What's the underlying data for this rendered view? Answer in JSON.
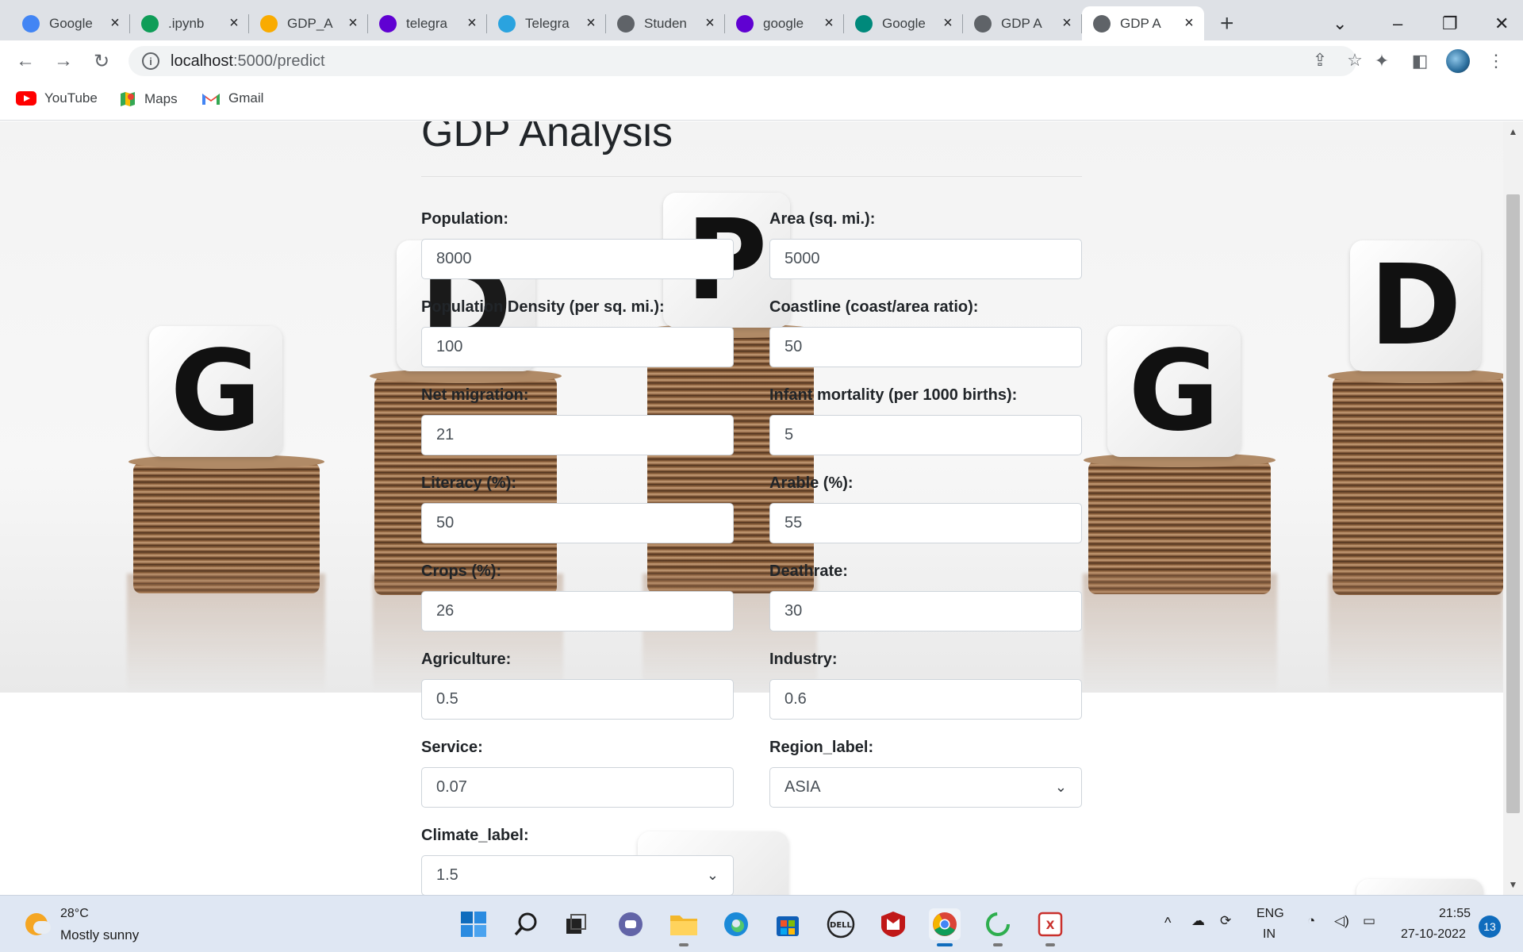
{
  "browser": {
    "tabs": [
      {
        "title": "Google",
        "favicon": "google-icon",
        "color": "#4285f4",
        "active": false
      },
      {
        "title": ".ipynb",
        "favicon": "drive-icon",
        "color": "#0f9d58",
        "active": false
      },
      {
        "title": "GDP_A",
        "favicon": "colab-icon",
        "color": "#f9ab00",
        "active": false
      },
      {
        "title": "telegra",
        "favicon": "yahoo-icon",
        "color": "#6001d2",
        "active": false
      },
      {
        "title": "Telegra",
        "favicon": "telegram-icon",
        "color": "#2aa3df",
        "active": false
      },
      {
        "title": "Studen",
        "favicon": "globe-icon",
        "color": "#5f6368",
        "active": false
      },
      {
        "title": "google",
        "favicon": "yahoo-icon",
        "color": "#6001d2",
        "active": false
      },
      {
        "title": "Google",
        "favicon": "meet-icon",
        "color": "#00897b",
        "active": false
      },
      {
        "title": "GDP A",
        "favicon": "globe-icon",
        "color": "#5f6368",
        "active": false
      },
      {
        "title": "GDP A",
        "favicon": "globe-icon",
        "color": "#5f6368",
        "active": true
      }
    ],
    "url_host": "localhost",
    "url_rest": ":5000/predict",
    "bookmarks": [
      {
        "label": "YouTube",
        "icon": "youtube-icon"
      },
      {
        "label": "Maps",
        "icon": "maps-icon"
      },
      {
        "label": "Gmail",
        "icon": "gmail-icon"
      }
    ]
  },
  "page": {
    "title": "GDP Analysis",
    "fields": [
      {
        "label": "Population:",
        "value": "8000",
        "type": "text"
      },
      {
        "label": "Area (sq. mi.):",
        "value": "5000",
        "type": "text"
      },
      {
        "label": "Population Density (per sq. mi.):",
        "value": "100",
        "type": "text"
      },
      {
        "label": "Coastline (coast/area ratio):",
        "value": "50",
        "type": "text"
      },
      {
        "label": "Net migration:",
        "value": "21",
        "type": "text"
      },
      {
        "label": "Infant mortality (per 1000 births):",
        "value": "5",
        "type": "text"
      },
      {
        "label": "Literacy (%):",
        "value": "50",
        "type": "text"
      },
      {
        "label": "Arable (%):",
        "value": "55",
        "type": "text"
      },
      {
        "label": "Crops (%):",
        "value": "26",
        "type": "text"
      },
      {
        "label": "Deathrate:",
        "value": "30",
        "type": "text"
      },
      {
        "label": "Agriculture:",
        "value": "0.5",
        "type": "text"
      },
      {
        "label": "Industry:",
        "value": "0.6",
        "type": "text"
      },
      {
        "label": "Service:",
        "value": "0.07",
        "type": "text"
      },
      {
        "label": "Region_label:",
        "value": "ASIA",
        "type": "select"
      },
      {
        "label": "Climate_label:",
        "value": "1.5",
        "type": "select"
      }
    ],
    "background_letters": [
      "G",
      "D",
      "P",
      "G",
      "D"
    ]
  },
  "taskbar": {
    "weather_temp": "28°C",
    "weather_desc": "Mostly sunny",
    "lang_top": "ENG",
    "lang_bottom": "IN",
    "time": "21:55",
    "date": "27-10-2022",
    "notifications": "13"
  }
}
